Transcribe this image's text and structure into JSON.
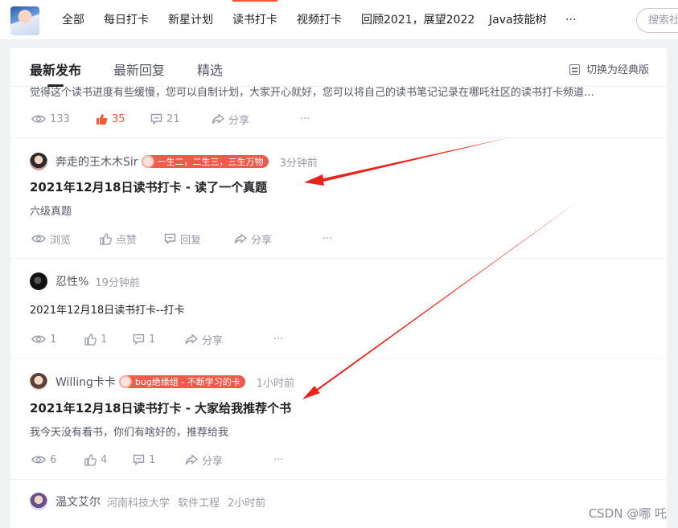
{
  "nav": {
    "items": [
      "全部",
      "每日打卡",
      "新星计划",
      "读书打卡",
      "视频打卡",
      "回顾2021，展望2022",
      "Java技能树",
      "···"
    ],
    "active_index": 3,
    "search_placeholder": "搜索社"
  },
  "tabs": {
    "items": [
      "最新发布",
      "最新回复",
      "精选"
    ],
    "active_index": 0,
    "switch_label": "切换为经典版"
  },
  "posts": [
    {
      "desc": "觉得这个读书进度有些缓慢，您可以自制计划，大家开心就好，您可以将自己的读书笔记记录在哪吒社区的读书打卡频道…",
      "actions": {
        "views": "133",
        "likes": "35",
        "comments": "21",
        "share": "分享",
        "more": "···"
      }
    },
    {
      "user": "奔走的王木木Sir",
      "badge": "一生二，二生三，三生万物",
      "time": "3分钟前",
      "title": "2021年12月18日读书打卡 - 读了一个真题",
      "desc": "六级真题",
      "actions": {
        "views": "浏览",
        "likes": "点赞",
        "comments": "回复",
        "share": "分享",
        "more": "···"
      }
    },
    {
      "user": "忍性%",
      "time": "19分钟前",
      "desc": "2021年12月18日读书打卡--打卡",
      "actions": {
        "views": "1",
        "likes": "1",
        "comments": "1",
        "share": "分享",
        "more": "···"
      }
    },
    {
      "user": "Willing卡卡",
      "badge": "bug绝缘组 - 不断学习的卡",
      "time": "1小时前",
      "title": "2021年12月18日读书打卡 - 大家给我推荐个书",
      "desc": "我今天没有看书，你们有啥好的，推荐给我",
      "actions": {
        "views": "6",
        "likes": "4",
        "comments": "1",
        "share": "分享",
        "more": "···"
      }
    },
    {
      "user": "温文艾尔",
      "school": "河南科技大学",
      "major": "软件工程",
      "time": "2小时前"
    }
  ],
  "watermark": "CSDN @哪 吒",
  "colors": {
    "accent": "#fc5531",
    "badge": "#ef5a4a",
    "arrow": "#e8231c"
  }
}
